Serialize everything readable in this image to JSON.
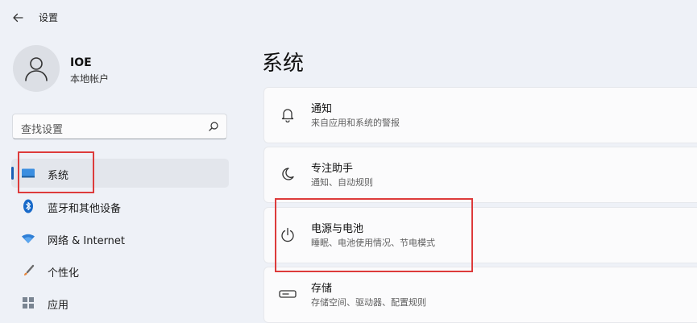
{
  "app": {
    "title": "设置"
  },
  "user": {
    "name": "IOE",
    "account": "本地帐户"
  },
  "search": {
    "placeholder": "查找设置"
  },
  "sidebar": {
    "items": [
      {
        "label": "系统",
        "icon": "system-icon",
        "selected": true
      },
      {
        "label": "蓝牙和其他设备",
        "icon": "bluetooth-icon"
      },
      {
        "label": "网络 & Internet",
        "icon": "network-icon"
      },
      {
        "label": "个性化",
        "icon": "brush-icon"
      },
      {
        "label": "应用",
        "icon": "apps-icon"
      }
    ]
  },
  "main": {
    "title": "系统",
    "cards": [
      {
        "title": "通知",
        "subtitle": "来自应用和系统的警报",
        "icon": "bell-icon"
      },
      {
        "title": "专注助手",
        "subtitle": "通知、自动规则",
        "icon": "moon-icon"
      },
      {
        "title": "电源与电池",
        "subtitle": "睡眠、电池使用情况、节电模式",
        "icon": "power-icon"
      },
      {
        "title": "存储",
        "subtitle": "存储空间、驱动器、配置规则",
        "icon": "storage-icon"
      }
    ]
  },
  "colors": {
    "accent": "#1a5fb4",
    "highlight": "#dd3b3b",
    "background": "#eef1f7"
  }
}
